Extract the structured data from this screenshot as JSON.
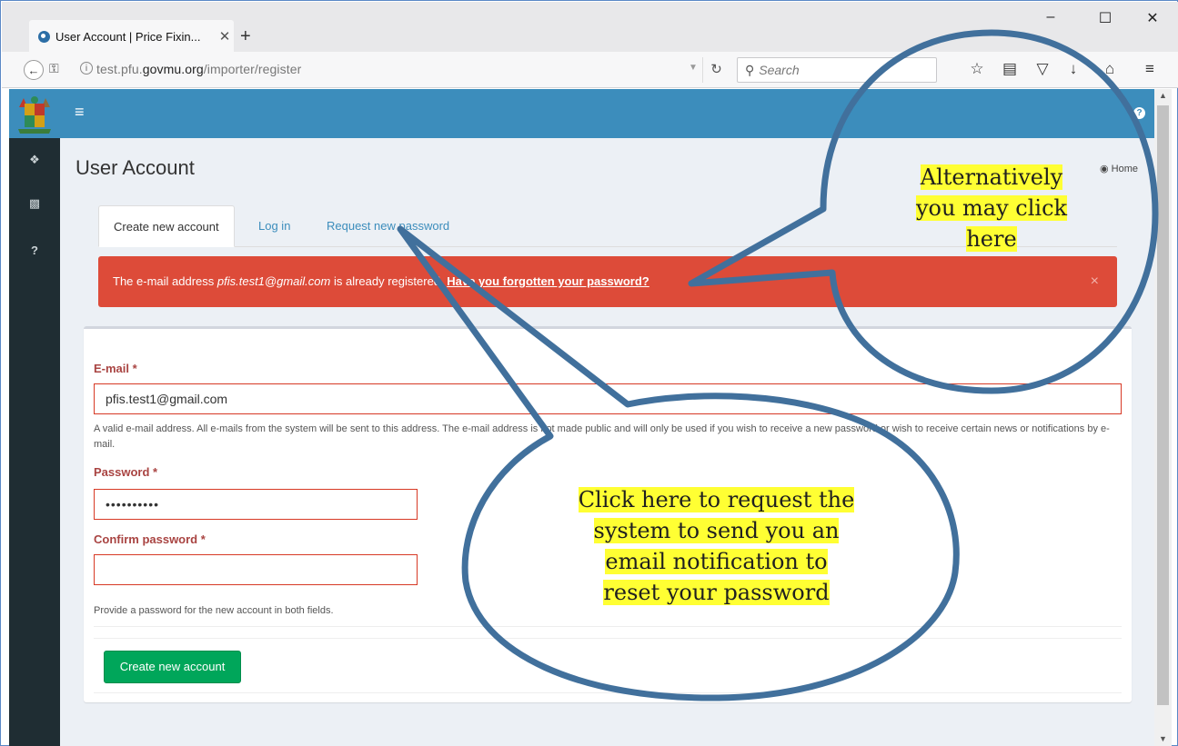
{
  "browser": {
    "tab_title": "User Account | Price Fixin...",
    "tab_close": "✕",
    "new_tab": "+",
    "url_prefix": "test.pfu.",
    "url_host": "govmu.org",
    "url_path": "/importer/register",
    "search_placeholder": "Search",
    "window_controls": [
      "–",
      "☐",
      "✕"
    ]
  },
  "app": {
    "page_title": "User Account",
    "breadcrumb_home": "Home",
    "sidebar_icons": [
      "home-icon",
      "pdf-icon",
      "help-icon"
    ],
    "accent_color": "#3c8dbc",
    "tabs": [
      {
        "label": "Create new account",
        "active": true
      },
      {
        "label": "Log in",
        "active": false
      },
      {
        "label": "Request new password",
        "active": false
      }
    ],
    "alert": {
      "prefix": "The e-mail address ",
      "email": "pfis.test1@gmail.com",
      "middle": " is already registered. ",
      "link": "Have you forgotten your password?",
      "close": "×",
      "color": "#dd4b39"
    },
    "form": {
      "email_label": "E-mail *",
      "email_value": "pfis.test1@gmail.com",
      "email_help": "A valid e-mail address. All e-mails from the system will be sent to this address. The e-mail address is not made public and will only be used if you wish to receive a new password or wish to receive certain news or notifications by e-mail.",
      "password_label": "Password *",
      "password_value": "••••••••••",
      "confirm_label": "Confirm password *",
      "confirm_value": "",
      "password_help": "Provide a password for the new account in both fields.",
      "submit_label": "Create new account"
    }
  },
  "callouts": {
    "top_right": [
      "Alternatively",
      "you may click",
      "here"
    ],
    "bottom": [
      "Click here to request the",
      "system to send you an",
      "email notification to",
      "reset your password"
    ],
    "highlight_color": "#ffff33",
    "outline_color": "#41709c"
  }
}
